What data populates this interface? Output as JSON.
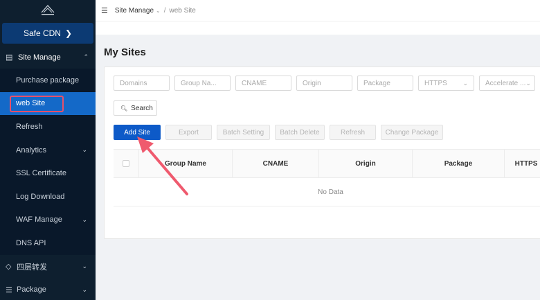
{
  "sidebar": {
    "cdn_label": "Safe CDN",
    "chevron": "❯",
    "group": {
      "label": "Site Manage",
      "icon": "▤",
      "caret": "⌃"
    },
    "items": [
      {
        "label": "Purchase package",
        "caret": ""
      },
      {
        "label": "web Site",
        "caret": "",
        "active": true
      },
      {
        "label": "Refresh",
        "caret": ""
      },
      {
        "label": "Analytics",
        "caret": "⌄"
      },
      {
        "label": "SSL Certificate",
        "caret": ""
      },
      {
        "label": "Log Download",
        "caret": ""
      },
      {
        "label": "WAF Manage",
        "caret": "⌄"
      },
      {
        "label": "DNS API",
        "caret": ""
      }
    ],
    "groups2": [
      {
        "label": "四层转发",
        "icon": "◇",
        "caret": "⌄"
      },
      {
        "label": "Package",
        "icon": "☰",
        "caret": "⌄"
      }
    ]
  },
  "topbar": {
    "menu_icon": "☰",
    "crumb_parent": "Site Manage",
    "crumb_dd": "⌄",
    "crumb_sep": "/",
    "crumb_current": "web Site"
  },
  "page_title": "My Sites",
  "filters": [
    {
      "placeholder": "Domains",
      "dd": ""
    },
    {
      "placeholder": "Group Na...",
      "dd": ""
    },
    {
      "placeholder": "CNAME",
      "dd": ""
    },
    {
      "placeholder": "Origin",
      "dd": ""
    },
    {
      "placeholder": "Package",
      "dd": ""
    },
    {
      "placeholder": "HTTPS",
      "dd": "⌄"
    },
    {
      "placeholder": "Accelerate ...",
      "dd": "⌄"
    }
  ],
  "search_label": "Search",
  "actions": [
    "Add Site",
    "Export",
    "Batch Setting",
    "Batch Delete",
    "Refresh",
    "Change Package"
  ],
  "table": {
    "headers": [
      "Group Name",
      "CNAME",
      "Origin",
      "Package",
      "HTTPS"
    ],
    "empty_text": "No Data"
  },
  "colors": {
    "sidebar_bg": "#0e1f2f",
    "accent": "#0d5ac8",
    "highlight": "#e8506a"
  }
}
